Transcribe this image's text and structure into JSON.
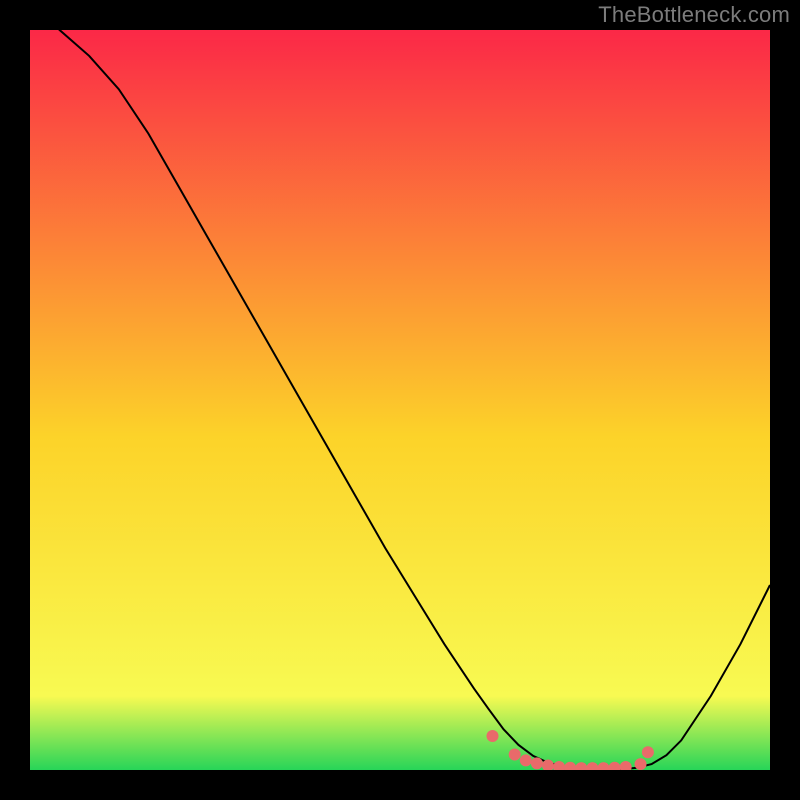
{
  "watermark": "TheBottleneck.com",
  "chart_data": {
    "type": "line",
    "title": "",
    "xlabel": "",
    "ylabel": "",
    "xlim": [
      0,
      100
    ],
    "ylim": [
      0,
      100
    ],
    "gradient_background": {
      "top_color": "#fb2847",
      "mid_color": "#fcd329",
      "lower_color": "#f8fa52",
      "bottom_color": "#27d558"
    },
    "series": [
      {
        "name": "curve",
        "color": "#000000",
        "stroke_width": 2,
        "x": [
          0,
          4,
          8,
          12,
          16,
          20,
          24,
          28,
          32,
          36,
          40,
          44,
          48,
          52,
          56,
          60,
          62,
          64,
          66,
          68,
          70,
          72,
          74,
          76,
          78,
          80,
          82,
          84,
          86,
          88,
          92,
          96,
          100
        ],
        "y": [
          104,
          100,
          96.5,
          92,
          86,
          79,
          72,
          65,
          58,
          51,
          44,
          37,
          30,
          23.5,
          17,
          11,
          8.2,
          5.5,
          3.4,
          1.9,
          1.0,
          0.5,
          0.2,
          0.1,
          0.1,
          0.1,
          0.3,
          0.8,
          2.0,
          4.0,
          10,
          17,
          25
        ]
      },
      {
        "name": "markers",
        "marker_color": "#e96a6a",
        "marker_radius": 6,
        "x": [
          62.5,
          65.5,
          67.0,
          68.5,
          70.0,
          71.5,
          73.0,
          74.5,
          76.0,
          77.5,
          79.0,
          80.5,
          82.5,
          83.5
        ],
        "y": [
          4.6,
          2.1,
          1.3,
          0.9,
          0.6,
          0.4,
          0.3,
          0.25,
          0.25,
          0.25,
          0.3,
          0.4,
          0.8,
          2.4
        ]
      }
    ]
  }
}
